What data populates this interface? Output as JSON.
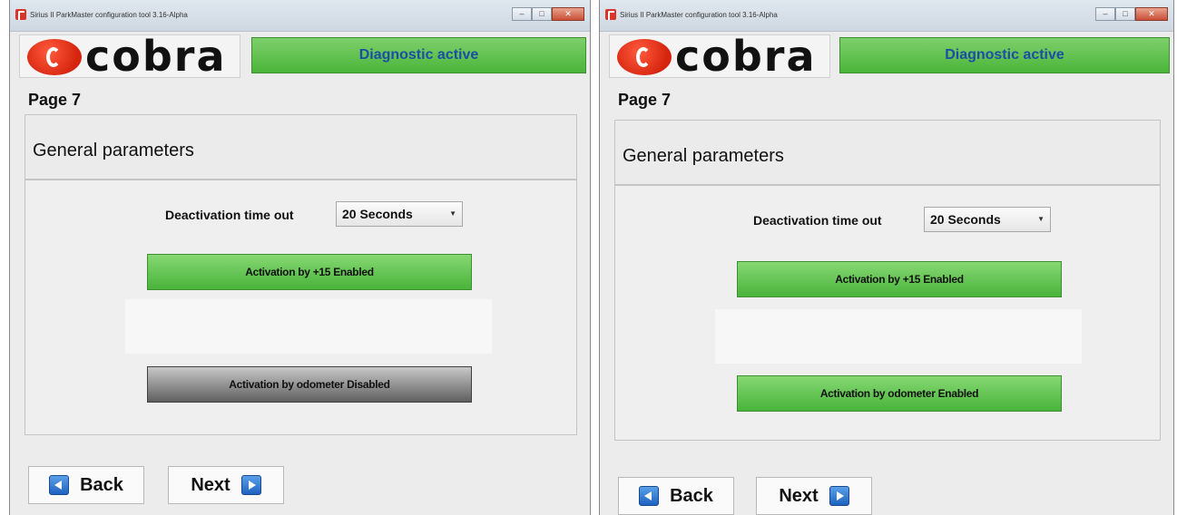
{
  "windows": [
    {
      "title": "Sirius II ParkMaster configuration tool  3.16-Alpha",
      "logo_text": "cobra",
      "status_button": "Diagnostic active",
      "page_label": "Page 7",
      "section_title": "General parameters",
      "timeout_label": "Deactivation time out",
      "timeout_value": "20 Seconds",
      "activation_15": "Activation by +15 Enabled",
      "activation_odometer": "Activation by odometer Disabled",
      "back_label": "Back",
      "next_label": "Next"
    },
    {
      "title": "Sirius II ParkMaster configuration tool  3.16-Alpha",
      "logo_text": "cobra",
      "status_button": "Diagnostic active",
      "page_label": "Page 7",
      "section_title": "General parameters",
      "timeout_label": "Deactivation time out",
      "timeout_value": "20 Seconds",
      "activation_15": "Activation by +15 Enabled",
      "activation_odometer": "Activation by odometer Enabled",
      "back_label": "Back",
      "next_label": "Next"
    }
  ],
  "colors": {
    "enabled_green": "#4ab53a",
    "disabled_gray": "#5f5f5f",
    "diagnostic_text": "#1b4fa6",
    "brand_red": "#d6250f"
  },
  "icons": {
    "back": "arrow-left-icon",
    "next": "arrow-right-icon",
    "app": "app-icon"
  }
}
